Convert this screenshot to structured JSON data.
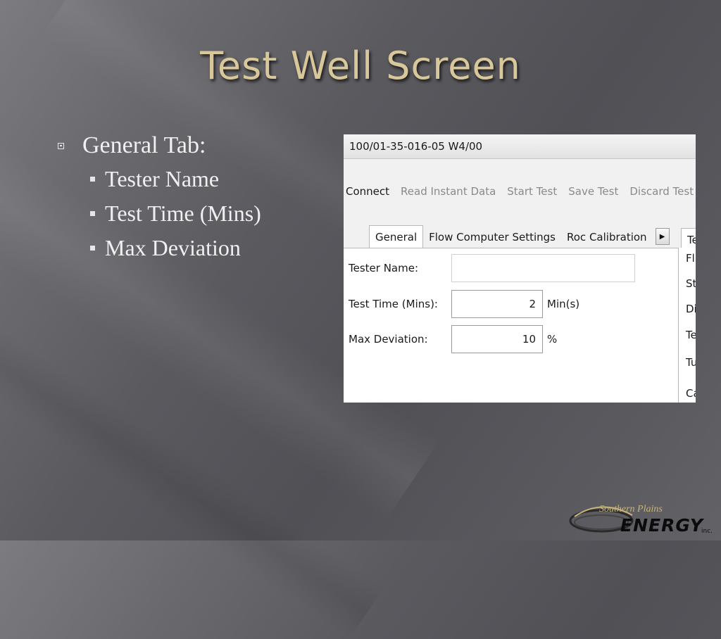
{
  "slide": {
    "title": "Test Well Screen"
  },
  "bullets": {
    "heading": "General Tab:",
    "items": [
      "Tester Name",
      "Test Time (Mins)",
      "Max Deviation"
    ]
  },
  "app": {
    "window_title": "100/01-35-016-05 W4/00",
    "toolbar": {
      "connect": "Connect",
      "read_instant_data": "Read Instant Data",
      "start_test": "Start Test",
      "save_test": "Save Test",
      "discard_test": "Discard Test"
    },
    "tabs": {
      "general": "General",
      "flow_computer_settings": "Flow Computer Settings",
      "roc_calibration": "Roc Calibration",
      "right_tab": "Te"
    },
    "form": {
      "tester_name_label": "Tester Name:",
      "tester_name_value": "",
      "test_time_label": "Test Time (Mins):",
      "test_time_value": "2",
      "test_time_unit": "Min(s)",
      "max_deviation_label": "Max Deviation:",
      "max_deviation_value": "10",
      "max_deviation_unit": "%"
    },
    "right_panel_labels": [
      "Fl",
      "St",
      "Di",
      "Te",
      "Tu",
      "Ca"
    ]
  },
  "logo": {
    "script_text": "Southern Plains",
    "main_text": "ENERGY",
    "suffix": "inc."
  },
  "colors": {
    "title": "#d8c79a",
    "bullet_text": "#f0f0f0",
    "background": "#5a5a5f"
  }
}
